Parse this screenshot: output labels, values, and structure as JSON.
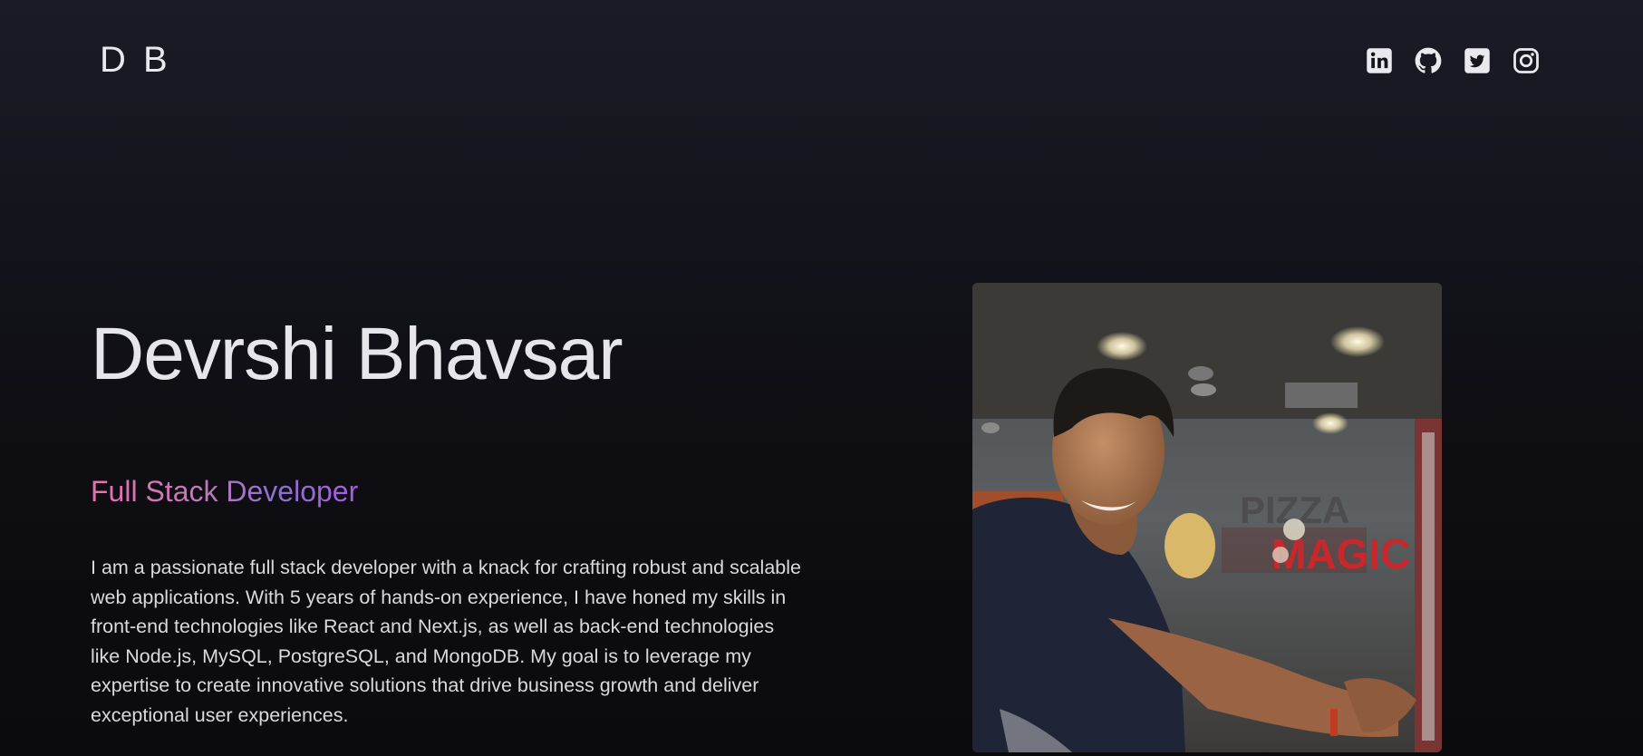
{
  "header": {
    "logo": "D B",
    "social": [
      {
        "name": "linkedin-icon"
      },
      {
        "name": "github-icon"
      },
      {
        "name": "twitter-icon"
      },
      {
        "name": "instagram-icon"
      }
    ]
  },
  "hero": {
    "name": "Devrshi Bhavsar",
    "role": "Full Stack Developer",
    "bio": "I am a passionate full stack developer with a knack for crafting robust and scalable web applications. With 5 years of hands-on experience, I have honed my skills in front-end technologies like React and Next.js, as well as back-end technologies like Node.js, MySQL, PostgreSQL, and MongoDB. My goal is to leverage my expertise to create innovative solutions that drive business growth and deliver exceptional user experiences."
  },
  "colors": {
    "background": "#0b0b0e",
    "text": "#e6e6ea",
    "gradient_start": "#ec6fb0",
    "gradient_end": "#a35ee0"
  }
}
